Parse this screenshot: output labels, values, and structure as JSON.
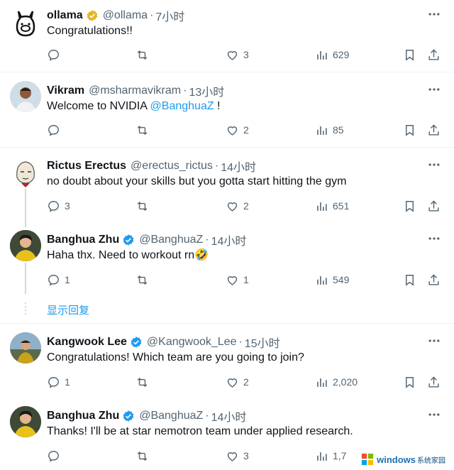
{
  "tweets": [
    {
      "name": "ollama",
      "verified": true,
      "handle": "@ollama",
      "sep": "·",
      "time": "7小时",
      "text": "Congratulations!!",
      "replies": "",
      "likes": "3",
      "views": "629"
    },
    {
      "name": "Vikram",
      "verified": false,
      "handle": "@msharmavikram",
      "sep": "·",
      "time": "13小时",
      "text_pre": "Welcome to NVIDIA ",
      "mention": "@BanghuaZ",
      "text_post": " !",
      "replies": "",
      "likes": "2",
      "views": "85"
    },
    {
      "name": "Rictus Erectus",
      "verified": false,
      "handle": "@erectus_rictus",
      "sep": "·",
      "time": "14小时",
      "text": "no doubt about your skills but you gotta start hitting the gym",
      "replies": "3",
      "likes": "2",
      "views": "651"
    },
    {
      "name": "Banghua Zhu",
      "verified": true,
      "handle": "@BanghuaZ",
      "sep": "·",
      "time": "14小时",
      "text": "Haha thx. Need to workout rn🤣",
      "replies": "1",
      "likes": "1",
      "views": "549"
    },
    {
      "name": "Kangwook Lee",
      "verified": true,
      "handle": "@Kangwook_Lee",
      "sep": "·",
      "time": "15小时",
      "text": "Congratulations!  Which team are you going to join?",
      "replies": "1",
      "likes": "2",
      "views": "2,020"
    },
    {
      "name": "Banghua Zhu",
      "verified": true,
      "handle": "@BanghuaZ",
      "sep": "·",
      "time": "14小时",
      "text": "Thanks! I'll be at star nemotron team under applied research.",
      "replies": "",
      "likes": "3",
      "views": "1,7"
    }
  ],
  "show_replies": "显示回复",
  "watermark": {
    "brand": "windows",
    "sub": "系统家园"
  },
  "colors": {
    "accent": "#1d9bf0",
    "muted": "#536471",
    "text": "#0f1419"
  }
}
